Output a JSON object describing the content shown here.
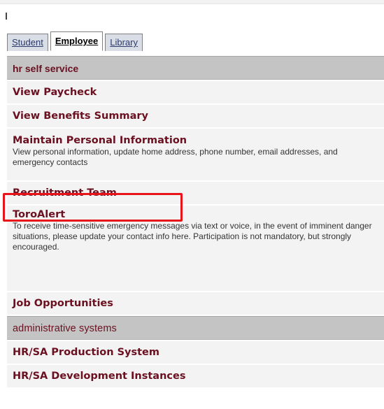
{
  "tabs": [
    {
      "label": "Student"
    },
    {
      "label": "Employee"
    },
    {
      "label": "Library"
    }
  ],
  "hr_section": {
    "header": "hr self service",
    "items": [
      {
        "title": "View Paycheck"
      },
      {
        "title": "View Benefits Summary"
      },
      {
        "title": "Maintain Personal Information",
        "description": "View personal information, update home address, phone number, email addresses, and emergency contacts"
      },
      {
        "title": "Recruitment Team"
      },
      {
        "title": "ToroAlert",
        "description": "To receive time-sensitive emergency messages via text or voice, in the event of imminent danger situations, please update your contact info here. Participation is not mandatory, but strongly encouraged."
      },
      {
        "title": "Job Opportunities"
      }
    ]
  },
  "admin_section": {
    "header": "administrative systems",
    "items": [
      {
        "title": "HR/SA Production System"
      },
      {
        "title": "HR/SA Development Instances"
      }
    ]
  },
  "colors": {
    "accent": "#6b1020",
    "highlight": "#e8141a",
    "header_bg": "#c4c4c4",
    "item_bg": "#f3f3f3"
  }
}
